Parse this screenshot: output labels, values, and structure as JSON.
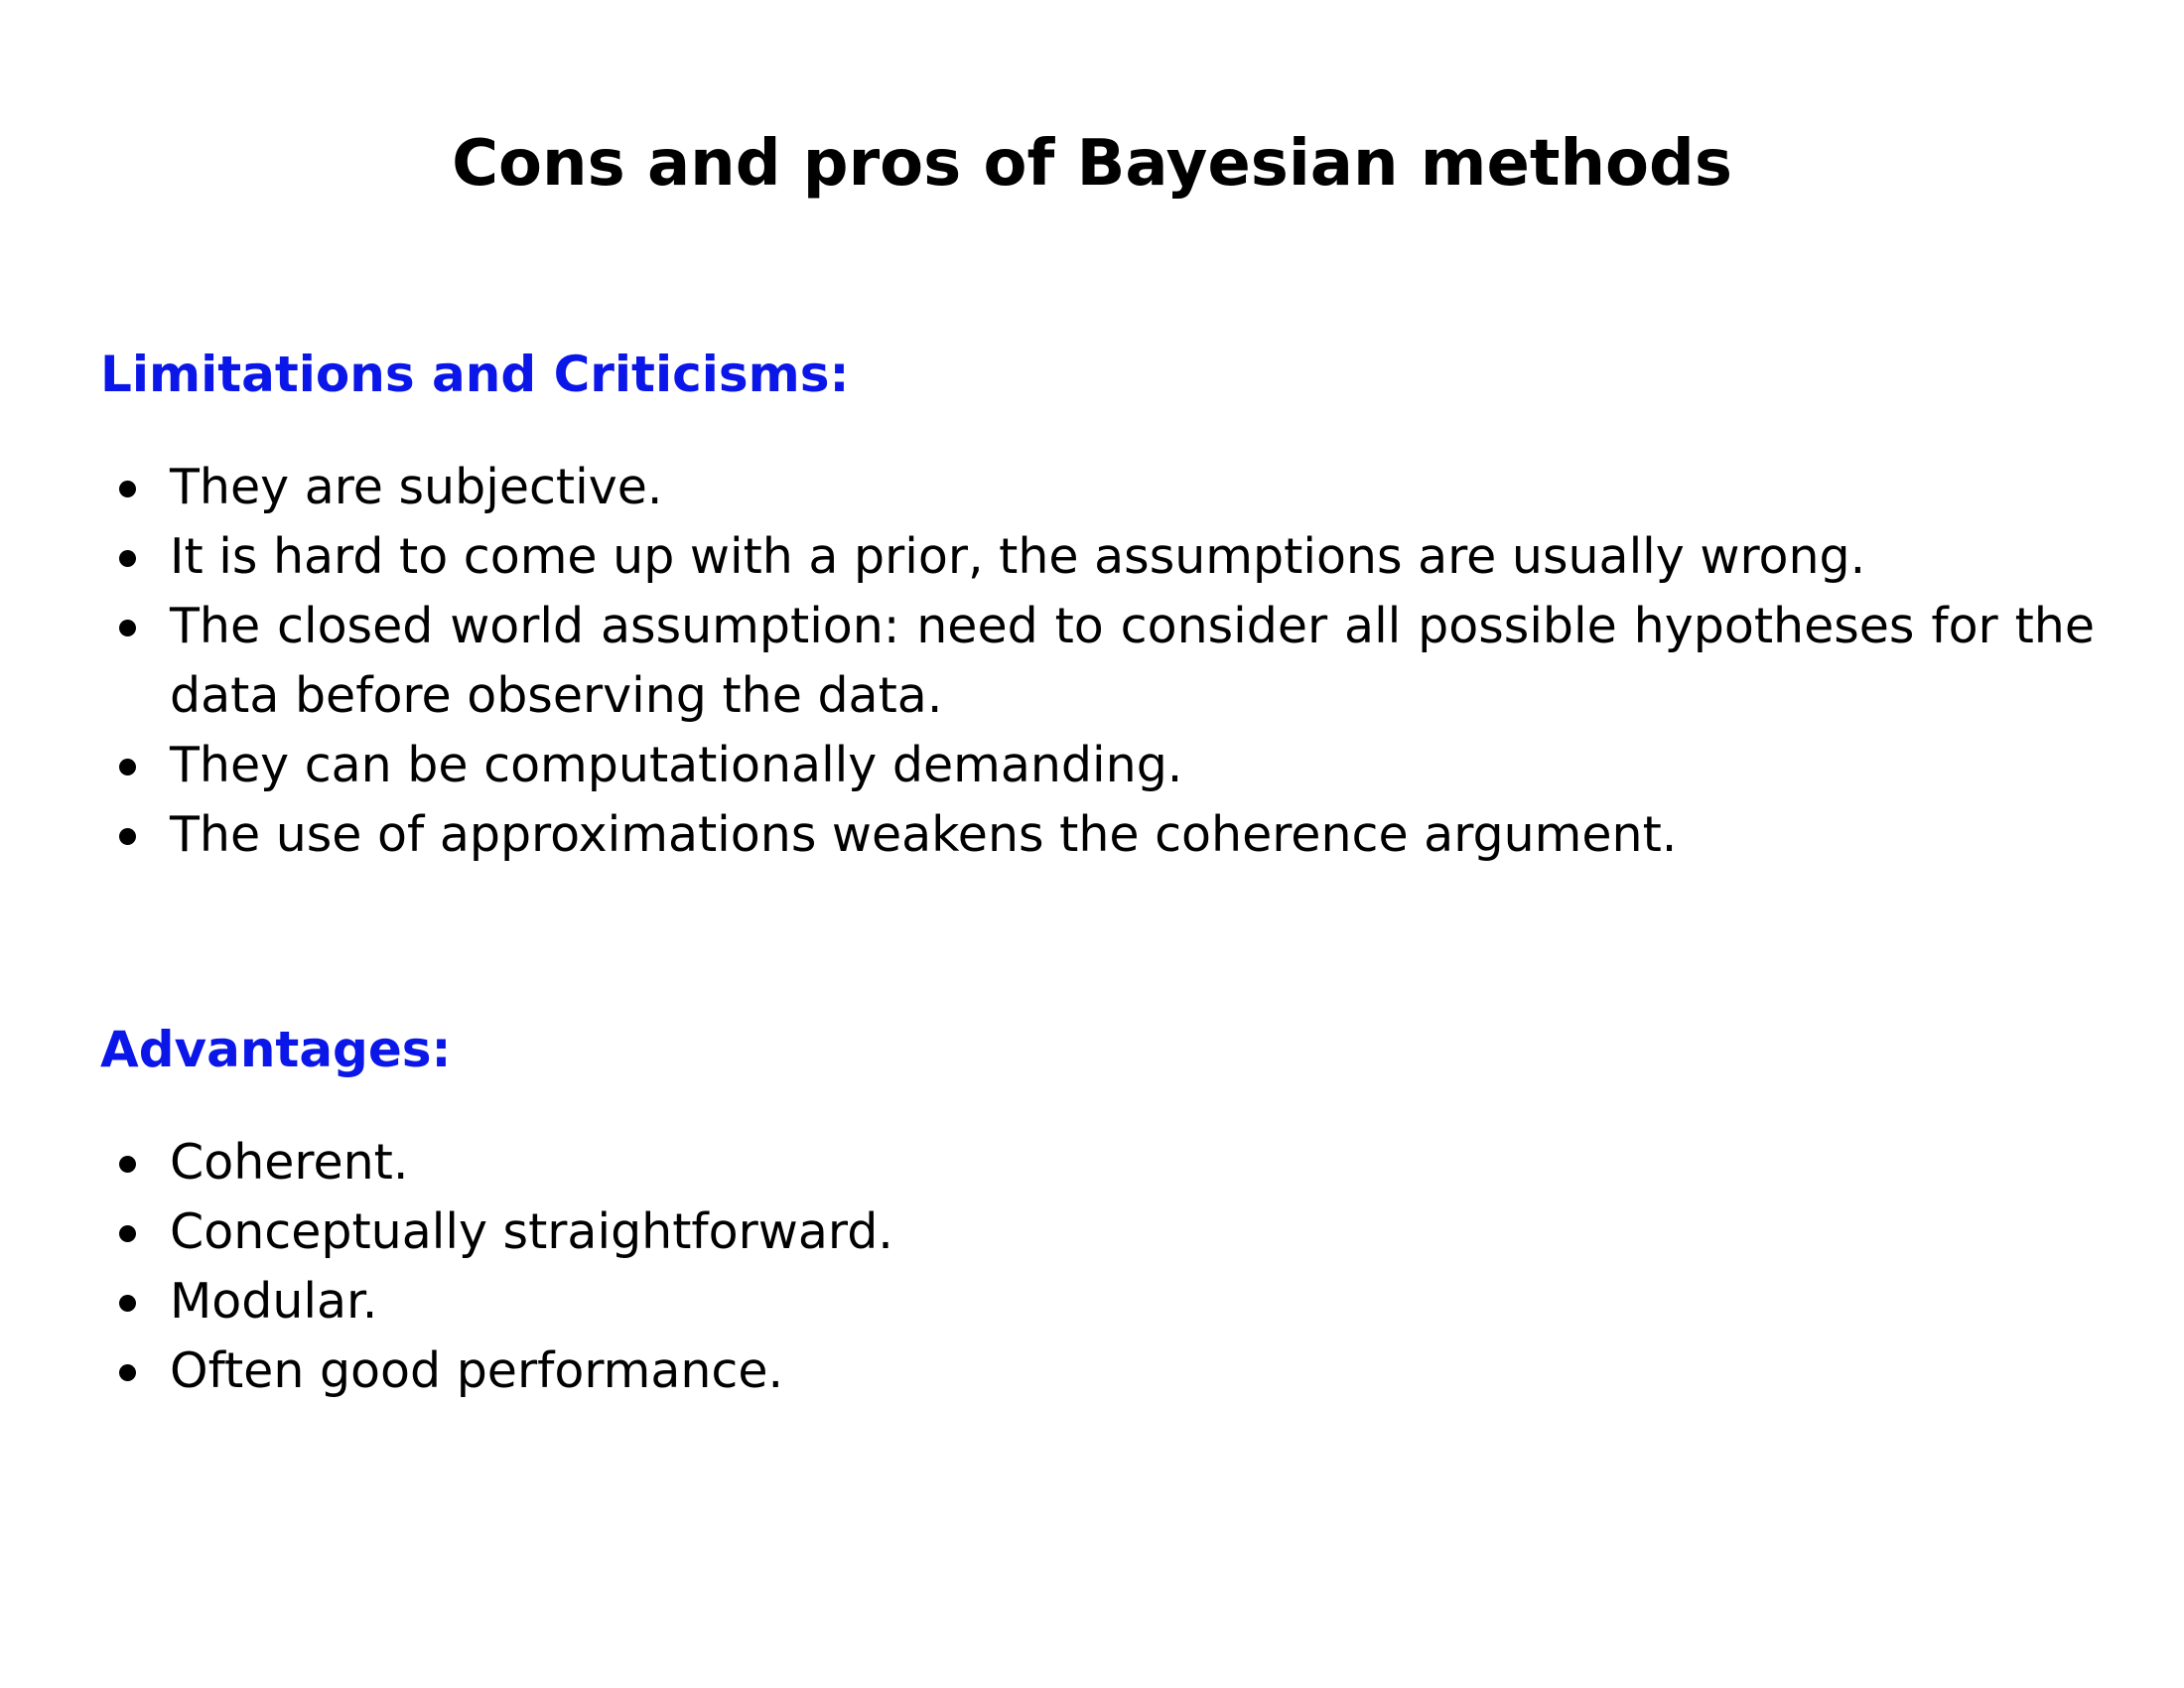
{
  "slide": {
    "title": "Cons and pros of Bayesian methods",
    "accent_color": "#0a17e8",
    "limitations": {
      "heading": "Limitations and Criticisms:",
      "items": [
        "They are subjective.",
        "It is hard to come up with a prior, the assumptions are usually wrong.",
        "The closed world assumption:  need to consider all possible hypotheses for the data before observing the data.",
        "They can be computationally demanding.",
        "The use of approximations weakens the coherence argument."
      ]
    },
    "advantages": {
      "heading": "Advantages:",
      "items": [
        "Coherent.",
        "Conceptually straightforward.",
        "Modular.",
        "Often good performance."
      ]
    }
  }
}
